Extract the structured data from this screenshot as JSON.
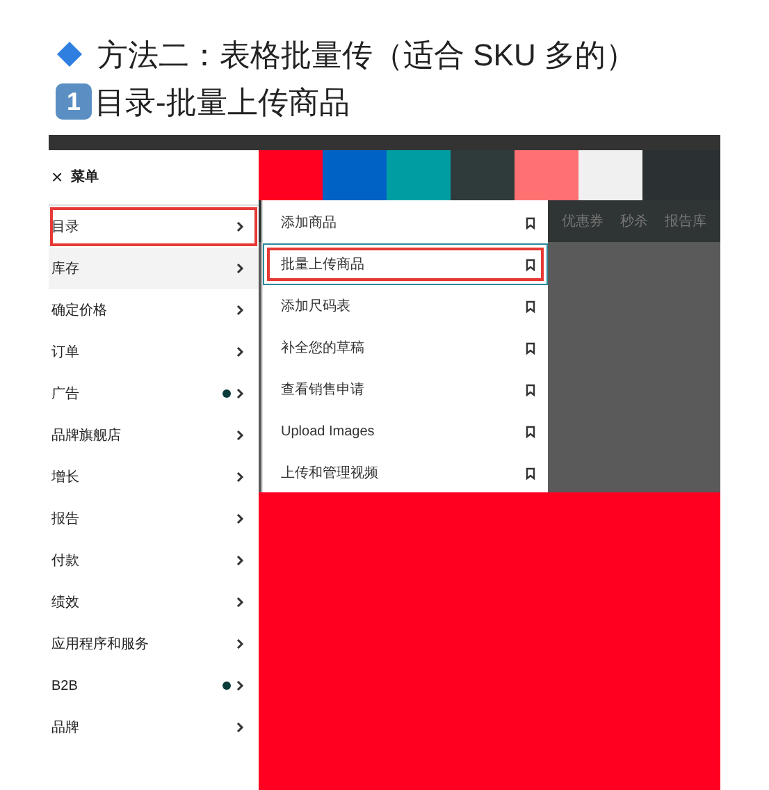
{
  "heading": {
    "title": "方法二：表格批量传（适合 SKU 多的）",
    "step_number": "1",
    "step_title": "目录-批量上传商品"
  },
  "menu": {
    "close": "×",
    "title": "菜单",
    "items": [
      {
        "label": "目录",
        "selected": false,
        "highlighted": true,
        "dot": false
      },
      {
        "label": "库存",
        "selected": true,
        "highlighted": false,
        "dot": false
      },
      {
        "label": "确定价格",
        "selected": false,
        "highlighted": false,
        "dot": false
      },
      {
        "label": "订单",
        "selected": false,
        "highlighted": false,
        "dot": false
      },
      {
        "label": "广告",
        "selected": false,
        "highlighted": false,
        "dot": true
      },
      {
        "label": "品牌旗舰店",
        "selected": false,
        "highlighted": false,
        "dot": false
      },
      {
        "label": "增长",
        "selected": false,
        "highlighted": false,
        "dot": false
      },
      {
        "label": "报告",
        "selected": false,
        "highlighted": false,
        "dot": false
      },
      {
        "label": "付款",
        "selected": false,
        "highlighted": false,
        "dot": false
      },
      {
        "label": "绩效",
        "selected": false,
        "highlighted": false,
        "dot": false
      },
      {
        "label": "应用程序和服务",
        "selected": false,
        "highlighted": false,
        "dot": false
      },
      {
        "label": "B2B",
        "selected": false,
        "highlighted": false,
        "dot": true
      },
      {
        "label": "品牌",
        "selected": false,
        "highlighted": false,
        "dot": false
      }
    ]
  },
  "nav_bar": [
    "优惠券",
    "秒杀",
    "报告库"
  ],
  "submenu": [
    {
      "label": "添加商品",
      "selected": false,
      "highlighted": false
    },
    {
      "label": "批量上传商品",
      "selected": true,
      "highlighted": true
    },
    {
      "label": "添加尺码表",
      "selected": false,
      "highlighted": false
    },
    {
      "label": "补全您的草稿",
      "selected": false,
      "highlighted": false
    },
    {
      "label": "查看销售申请",
      "selected": false,
      "highlighted": false
    },
    {
      "label": "Upload Images",
      "selected": false,
      "highlighted": false
    },
    {
      "label": "上传和管理视频",
      "selected": false,
      "highlighted": false
    }
  ]
}
